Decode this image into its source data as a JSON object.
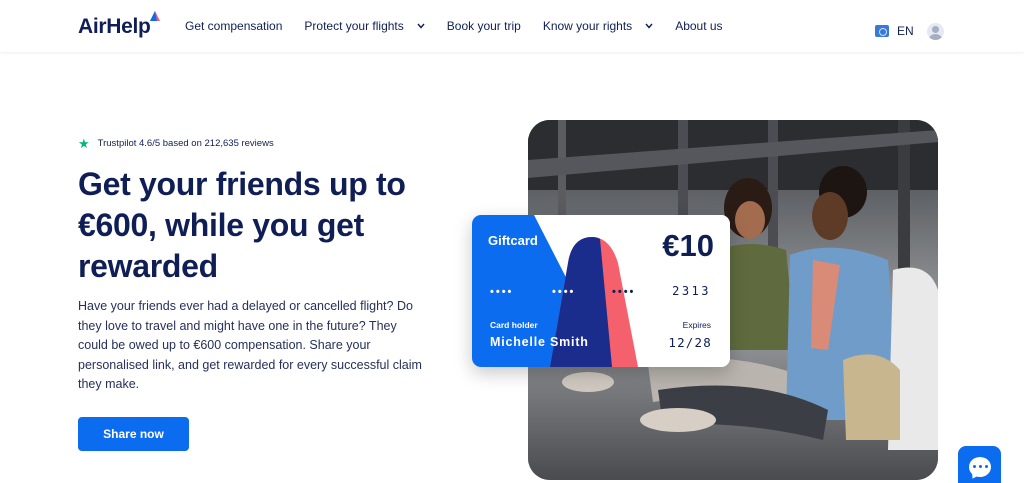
{
  "header": {
    "logo": "AirHelp",
    "nav": [
      {
        "label": "Get compensation",
        "dropdown": false
      },
      {
        "label": "Protect your flights",
        "dropdown": true
      },
      {
        "label": "Book your trip",
        "dropdown": false
      },
      {
        "label": "Know your rights",
        "dropdown": true
      },
      {
        "label": "About us",
        "dropdown": false
      }
    ],
    "language": "EN"
  },
  "hero": {
    "trustpilot": "Trustpilot 4.6/5 based on 212,635 reviews",
    "title": "Get your friends up to €600, while you get rewarded",
    "description": "Have your friends ever had a delayed or cancelled flight? Do they love to travel and might have one in the future? They could be owed up to €600 compensation. Share your personalised link, and get rewarded for every successful claim they make.",
    "cta": "Share now"
  },
  "giftcard": {
    "label": "Giftcard",
    "amount": "€10",
    "dots": [
      "••••",
      "••••",
      "••••"
    ],
    "last_digits": "2313",
    "holder_label": "Card holder",
    "holder": "Michelle Smith",
    "expires_label": "Expires",
    "expires": "12/28"
  },
  "colors": {
    "brand_navy": "#0f1f56",
    "primary_blue": "#0c6cf0",
    "trustpilot_green": "#00b67a",
    "card_coral": "#f5606d"
  },
  "icons": {
    "trustpilot": "star-icon",
    "language": "globe-flag-icon",
    "account": "user-avatar-icon",
    "chat": "chat-bubble-icon"
  }
}
